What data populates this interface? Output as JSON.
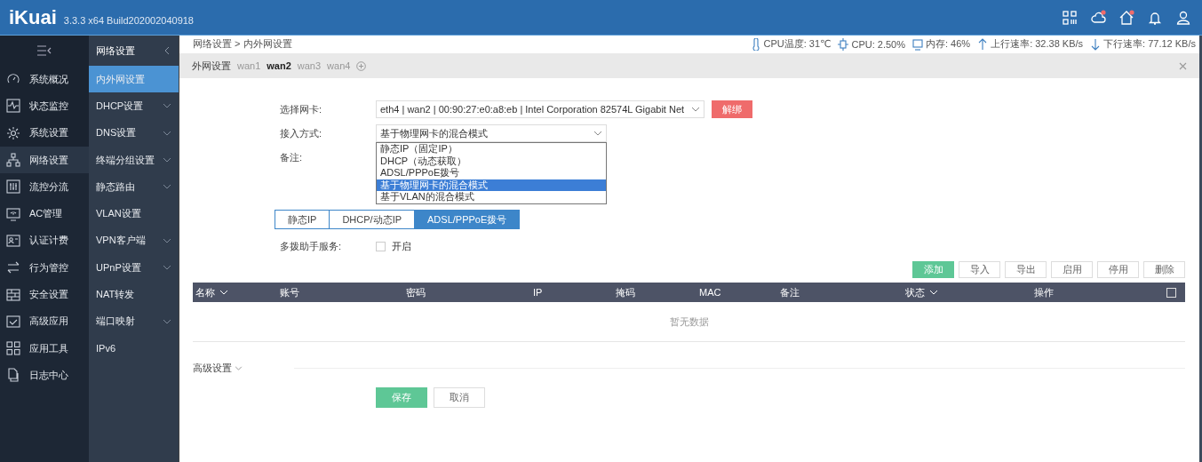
{
  "header": {
    "logo": "iKuai",
    "version": "3.3.3 x64 Build202002040918",
    "icons": [
      {
        "badge": false
      },
      {
        "badge": true
      },
      {
        "badge": true
      },
      {
        "badge": false
      },
      {
        "badge": false
      }
    ]
  },
  "sidebar": {
    "items": [
      {
        "label": "系统概况",
        "selected": false
      },
      {
        "label": "状态监控",
        "selected": false
      },
      {
        "label": "系统设置",
        "selected": false
      },
      {
        "label": "网络设置",
        "selected": true
      },
      {
        "label": "流控分流",
        "selected": false
      },
      {
        "label": "AC管理",
        "selected": false
      },
      {
        "label": "认证计费",
        "selected": false
      },
      {
        "label": "行为管控",
        "selected": false
      },
      {
        "label": "安全设置",
        "selected": false
      },
      {
        "label": "高级应用",
        "selected": false
      },
      {
        "label": "应用工具",
        "selected": false
      },
      {
        "label": "日志中心",
        "selected": false
      }
    ]
  },
  "submenu": {
    "title": "网络设置",
    "items": [
      {
        "label": "内外网设置",
        "selected": true,
        "expandable": false
      },
      {
        "label": "DHCP设置",
        "selected": false,
        "expandable": true
      },
      {
        "label": "DNS设置",
        "selected": false,
        "expandable": true
      },
      {
        "label": "终端分组设置",
        "selected": false,
        "expandable": true
      },
      {
        "label": "静态路由",
        "selected": false,
        "expandable": true
      },
      {
        "label": "VLAN设置",
        "selected": false,
        "expandable": false
      },
      {
        "label": "VPN客户端",
        "selected": false,
        "expandable": true
      },
      {
        "label": "UPnP设置",
        "selected": false,
        "expandable": true
      },
      {
        "label": "NAT转发",
        "selected": false,
        "expandable": false
      },
      {
        "label": "端口映射",
        "selected": false,
        "expandable": true
      },
      {
        "label": "IPv6",
        "selected": false,
        "expandable": false
      }
    ]
  },
  "breadcrumb": "网络设置 > 内外网设置",
  "stats": [
    "CPU温度: 31℃",
    "CPU: 2.50%",
    "内存: 46%",
    "上行速率: 32.38 KB/s",
    "下行速率: 77.12 KB/s"
  ],
  "page_tabs": [
    {
      "label": "外网设置",
      "selected": false
    },
    {
      "label": "wan1",
      "selected": false
    },
    {
      "label": "wan2",
      "selected": true
    },
    {
      "label": "wan3",
      "selected": false
    },
    {
      "label": "wan4",
      "selected": false
    }
  ],
  "form": {
    "nic_label": "选择网卡:",
    "nic_value": "eth4 | wan2 | 00:90:27:e0:a8:eb | Intel Corporation 82574L Gigabit Net",
    "unbind_button": "解绑",
    "mode_label": "接入方式:",
    "mode_value": "基于物理网卡的混合模式",
    "mode_options": [
      {
        "label": "静态IP（固定IP）",
        "selected": false
      },
      {
        "label": "DHCP（动态获取）",
        "selected": false
      },
      {
        "label": "ADSL/PPPoE拨号",
        "selected": false
      },
      {
        "label": "基于物理网卡的混合模式",
        "selected": true
      },
      {
        "label": "基于VLAN的混合模式",
        "selected": false
      }
    ],
    "note_label": "备注:"
  },
  "mode_tabs": [
    {
      "label": "静态IP",
      "selected": false
    },
    {
      "label": "DHCP/动态IP",
      "selected": false
    },
    {
      "label": "ADSL/PPPoE拨号",
      "selected": true
    }
  ],
  "multi_dial": {
    "label": "多拨助手服务:",
    "checkbox_label": "开启",
    "checked": false
  },
  "toolbar": [
    {
      "label": "添加",
      "kind": "primary"
    },
    {
      "label": "导入",
      "kind": "plain"
    },
    {
      "label": "导出",
      "kind": "plain"
    },
    {
      "label": "启用",
      "kind": "plain"
    },
    {
      "label": "停用",
      "kind": "plain"
    },
    {
      "label": "删除",
      "kind": "plain"
    }
  ],
  "table": {
    "columns": [
      {
        "label": "名称",
        "sortable": true
      },
      {
        "label": "账号",
        "sortable": false
      },
      {
        "label": "密码",
        "sortable": false
      },
      {
        "label": "IP",
        "sortable": false
      },
      {
        "label": "掩码",
        "sortable": false
      },
      {
        "label": "MAC",
        "sortable": false
      },
      {
        "label": "备注",
        "sortable": false
      },
      {
        "label": "状态",
        "sortable": true
      },
      {
        "label": "操作",
        "sortable": false
      }
    ],
    "select_all": false,
    "empty_text": "暂无数据"
  },
  "advanced": "高级设置",
  "buttons": [
    {
      "label": "保存",
      "kind": "primary"
    },
    {
      "label": "取消",
      "kind": "plain"
    }
  ]
}
